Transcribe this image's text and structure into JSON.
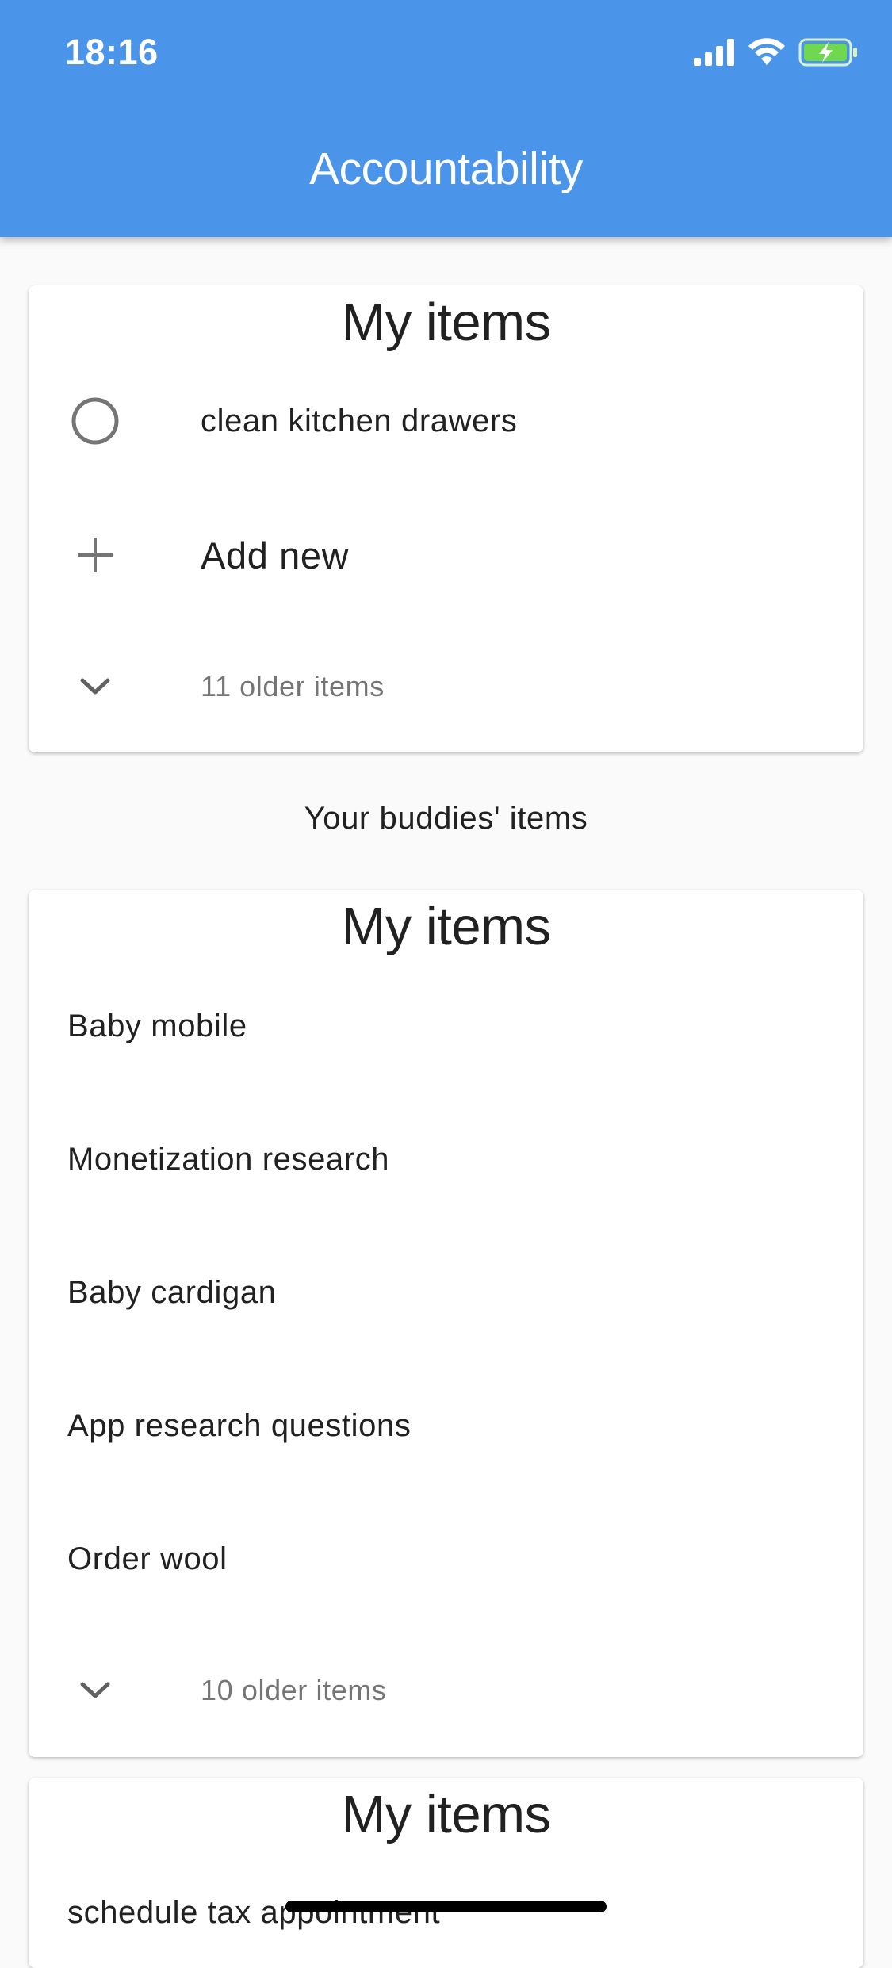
{
  "status_bar": {
    "time": "18:16",
    "icons": [
      "cellular-signal-icon",
      "wifi-icon",
      "battery-charging-icon"
    ]
  },
  "app_bar": {
    "title": "Accountability",
    "background_color": "#4a94ea"
  },
  "my_card": {
    "title": "My items",
    "items": [
      {
        "label": "clean kitchen drawers",
        "icon": "circle-checkbox-icon"
      }
    ],
    "add_new_label": "Add new",
    "older_label": "11 older items"
  },
  "buddies_section": {
    "label": "Your buddies' items"
  },
  "buddy_card_1": {
    "title": "My items",
    "items": [
      {
        "label": "Baby mobile"
      },
      {
        "label": "Monetization research"
      },
      {
        "label": "Baby cardigan"
      },
      {
        "label": "App research questions"
      },
      {
        "label": "Order wool"
      }
    ],
    "older_label": "10 older items"
  },
  "buddy_card_2": {
    "title": "My items",
    "items": [
      {
        "label": "schedule tax appointment"
      }
    ]
  }
}
